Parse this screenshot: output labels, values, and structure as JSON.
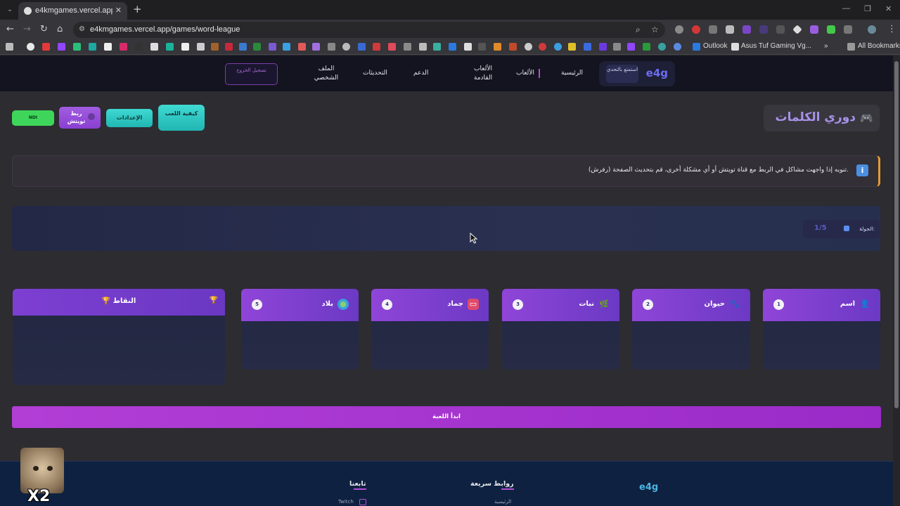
{
  "browser": {
    "tab_title": "e4kmgames.vercel.app/games/",
    "url": "e4kmgames.vercel.app/games/word-league",
    "bookmarks": {
      "outlook": "Outlook",
      "asus": "Asus Tuf Gaming Vg...",
      "all": "All Bookmarks"
    }
  },
  "header": {
    "logo": "e4g",
    "logo_tag": "استمتع بالتحدي",
    "nav": {
      "home": "الرئيسية",
      "games": "الألعاب",
      "upcoming": "الألعاب القادمة",
      "support": "الدعم",
      "updates": "التحديثات",
      "profile": "الملف الشخصي",
      "logout": "تسجيل الخروج"
    }
  },
  "game": {
    "title": "دوري الكلمات",
    "controls": {
      "how_to_play": "كيفية اللعب",
      "settings": "الإعدادات",
      "link_twitch": "ربط تويتش",
      "ndi": "NDI"
    },
    "notice": "تنويه إذا واجهت مشاكل في الربط مع قناة تويتش أو أي مشكلة أخرى، قم بتحديث الصفحة (رفرش).",
    "round_label": "الجولة:",
    "round_value": "1/5",
    "categories": [
      {
        "num": "1",
        "label": "اسم"
      },
      {
        "num": "2",
        "label": "حيوان"
      },
      {
        "num": "3",
        "label": "نبات"
      },
      {
        "num": "4",
        "label": "جماد"
      },
      {
        "num": "5",
        "label": "بلاد"
      }
    ],
    "scores_title": "النقاط",
    "start": "ابدأ اللعبة"
  },
  "footer": {
    "logo": "e4g",
    "quick_links": "روابط سريعة",
    "home_link": "الرئيسية",
    "follow_us": "تابعنا",
    "twitch": "Twitch"
  },
  "overlay": {
    "speed": "X2"
  },
  "colors": {
    "accent_purple": "#8f45d8",
    "accent_teal": "#3fd9d2",
    "ndi_green": "#3ed65a",
    "notice_orange": "#e39a33",
    "logo_blue": "#6d6cf0"
  }
}
